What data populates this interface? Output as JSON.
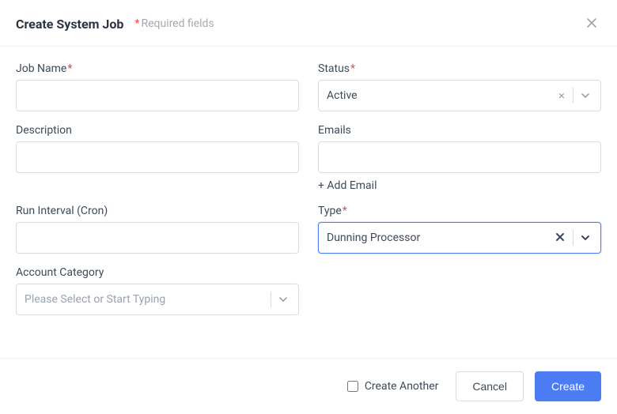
{
  "header": {
    "title": "Create System Job",
    "required_note": "Required fields"
  },
  "fields": {
    "job_name": {
      "label": "Job Name",
      "value": "",
      "required": true
    },
    "status": {
      "label": "Status",
      "value": "Active",
      "required": true
    },
    "description": {
      "label": "Description",
      "value": ""
    },
    "emails": {
      "label": "Emails",
      "value": "",
      "add_label": "+ Add Email"
    },
    "run_interval": {
      "label": "Run Interval (Cron)",
      "value": ""
    },
    "type": {
      "label": "Type",
      "value": "Dunning Processor",
      "required": true
    },
    "account_category": {
      "label": "Account Category",
      "placeholder": "Please Select or Start Typing"
    }
  },
  "footer": {
    "create_another": "Create Another",
    "cancel": "Cancel",
    "create": "Create"
  }
}
